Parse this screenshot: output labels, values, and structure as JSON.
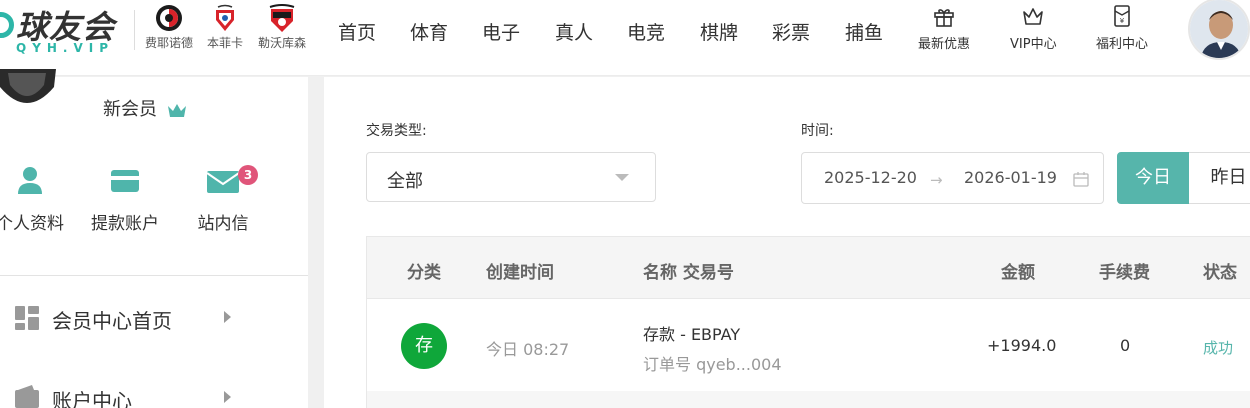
{
  "brand": {
    "name": "球友会",
    "sub": "QYH.VIP"
  },
  "clubs": [
    {
      "name": "费耶诺德"
    },
    {
      "name": "本菲卡"
    },
    {
      "name": "勒沃库森"
    }
  ],
  "nav": [
    "首页",
    "体育",
    "电子",
    "真人",
    "电竞",
    "棋牌",
    "彩票",
    "捕鱼"
  ],
  "utility": {
    "promo": "最新优惠",
    "vip": "VIP中心",
    "welfare": "福利中心"
  },
  "sidebar": {
    "level": "新会员",
    "quick": [
      {
        "label": "个人资料"
      },
      {
        "label": "提款账户"
      },
      {
        "label": "站内信",
        "badge": "3"
      }
    ],
    "menu": [
      {
        "label": "会员中心首页"
      },
      {
        "label": "账户中心"
      }
    ]
  },
  "filters": {
    "type_label": "交易类型:",
    "type_value": "全部",
    "time_label": "时间:",
    "start_date": "2025-12-20",
    "end_date": "2026-01-19",
    "quick": [
      "今日",
      "昨日"
    ]
  },
  "table": {
    "headers": [
      "分类",
      "创建时间",
      "名称 交易号",
      "金额",
      "手续费",
      "状态"
    ],
    "rows": [
      {
        "category": "存",
        "time": "今日 08:27",
        "name": "存款 - EBPAY",
        "order": "订单号 qyeb...004",
        "amount": "+1994.0",
        "fee": "0",
        "status": "成功"
      }
    ]
  },
  "colors": {
    "accent": "#56b5ab",
    "deposit": "#0fa73a",
    "badge": "#e0557a",
    "success": "#56b5ab"
  }
}
